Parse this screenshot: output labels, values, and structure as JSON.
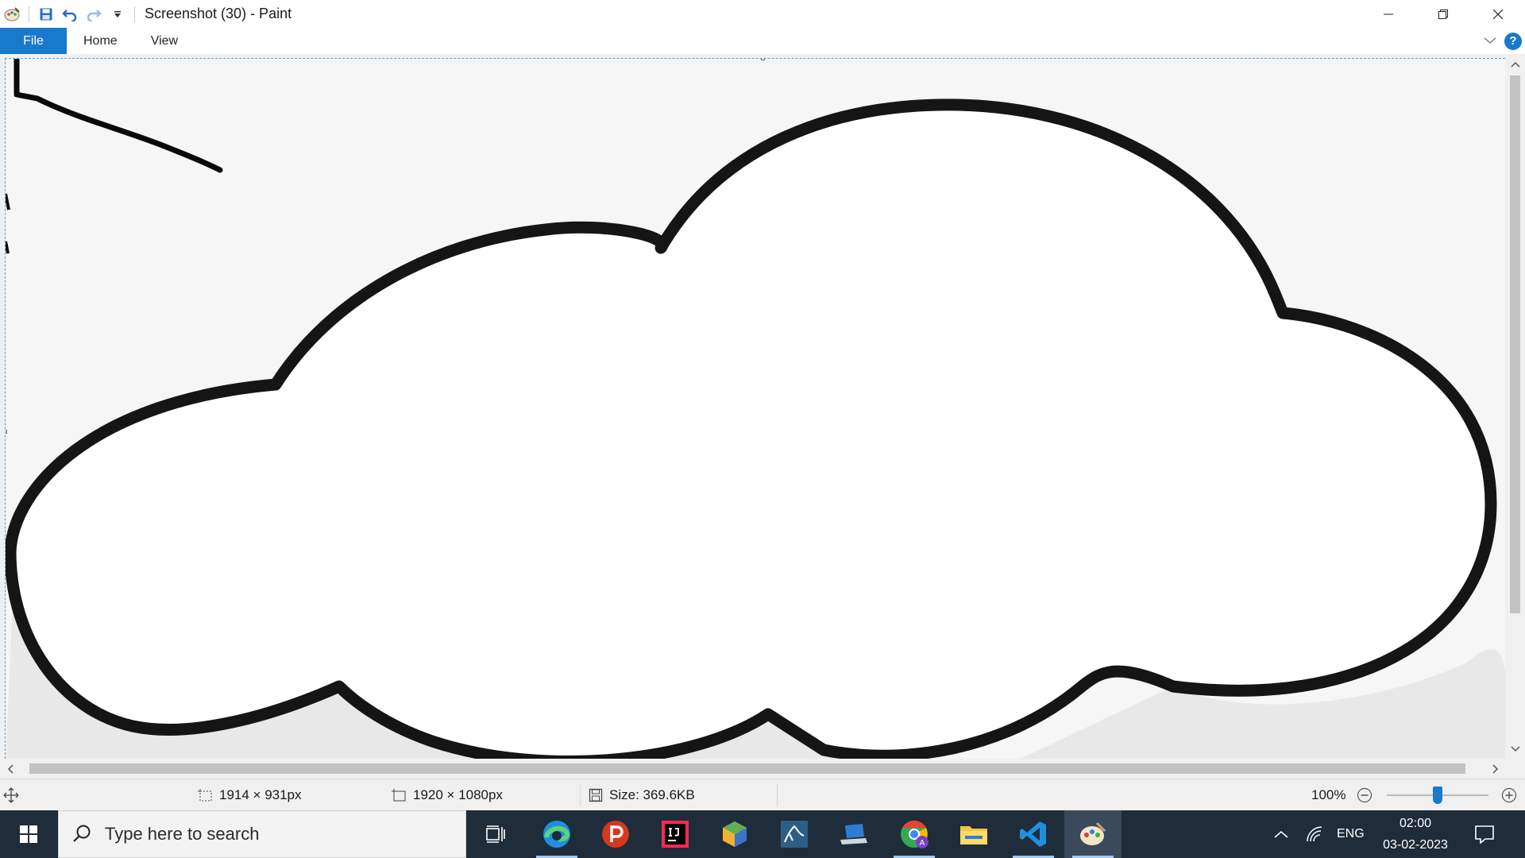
{
  "window": {
    "title": "Screenshot (30) - Paint"
  },
  "ribbon": {
    "tabs": [
      {
        "label": "File",
        "active": true
      },
      {
        "label": "Home",
        "active": false
      },
      {
        "label": "View",
        "active": false
      }
    ],
    "help_glyph": "?"
  },
  "status": {
    "selection_size": "1914 × 931px",
    "image_size": "1920 × 1080px",
    "file_size": "Size: 369.6KB",
    "zoom": "100%",
    "zoom_level": 0.5
  },
  "taskbar": {
    "search_placeholder": "Type here to search",
    "apps": [
      {
        "name": "task-view-icon"
      },
      {
        "name": "edge-icon"
      },
      {
        "name": "p-app-icon"
      },
      {
        "name": "intellij-icon"
      },
      {
        "name": "box-app-icon"
      },
      {
        "name": "mysql-workbench-icon"
      },
      {
        "name": "laptop-app-icon"
      },
      {
        "name": "chrome-icon"
      },
      {
        "name": "file-explorer-icon"
      },
      {
        "name": "vscode-icon"
      },
      {
        "name": "paint-icon",
        "active": true
      }
    ],
    "language": "ENG",
    "time": "02:00",
    "date": "03-02-2023"
  },
  "colors": {
    "accent": "#1979ca",
    "taskbar": "#1f2c3a",
    "canvas": "#f6f6f6"
  }
}
